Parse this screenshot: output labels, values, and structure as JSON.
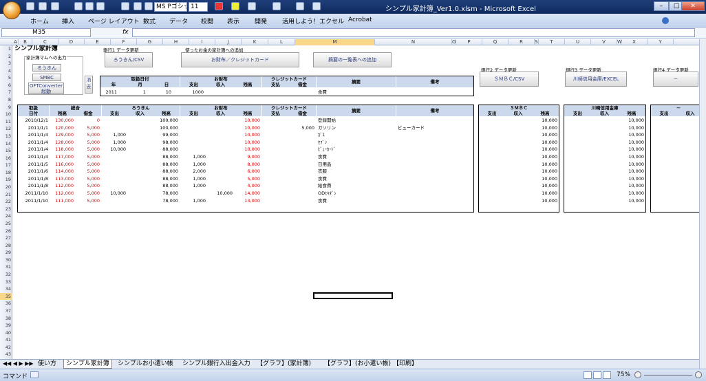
{
  "window": {
    "title": "シンプル家計簿_Ver1.0.xlsm - Microsoft Excel",
    "minimize": "–",
    "restore": "□",
    "close": "✕"
  },
  "quick_access": {
    "font_name": "MS Pゴシッ",
    "font_size": "11"
  },
  "ribbon_tabs": [
    "ホーム",
    "挿入",
    "ページ レイアウト",
    "数式",
    "データ",
    "校閲",
    "表示",
    "開発",
    "活用しよう！エクセル",
    "Acrobat"
  ],
  "formula_bar": {
    "name_box": "M35",
    "fx": "fx",
    "value": ""
  },
  "columns": [
    "A",
    "B",
    "C",
    "D",
    "E",
    "F",
    "G",
    "H",
    "I",
    "J",
    "K",
    "L",
    "M",
    "N",
    "O",
    "P",
    "Q",
    "R",
    "S",
    "T",
    "U",
    "V",
    "W",
    "X",
    "Y"
  ],
  "sheet": {
    "title": "シンプル家計簿",
    "group_output": "家計簿マムへの出力",
    "btn_rokin": "ろうきん",
    "btn_smbc": "SMBC",
    "btn_ofx": "OFTConverter起動",
    "btn_clear": "消去",
    "group_bank1": "銀行1 データ更新",
    "btn_bank1": "ろうきん/CSV",
    "group_add": "使ったお金の家計簿への追加",
    "btn_add": "お財布／クレジットカード",
    "btn_summary": "摘要の一覧表への追加",
    "group_bank2": "銀行2 データ更新",
    "btn_bank2": "ＳＭＢＣ/CSV",
    "group_bank3": "銀行3 データ更新",
    "btn_bank3": "川崎信用金庫/EXCEL",
    "group_bank4": "銀行4 データ更新",
    "btn_bank4": "－",
    "input_header": {
      "date": "取扱日付",
      "year": "年",
      "month": "月",
      "day": "日",
      "wallet": "お財布",
      "out": "支出",
      "in": "収入",
      "bal": "残高",
      "credit": "クレジットカード",
      "pay": "支払",
      "debt": "借金",
      "memo": "摘要",
      "note": "備考"
    },
    "input_row": {
      "year": "2011",
      "month": "1",
      "day": "10",
      "wallet_out": "1000",
      "memo": "食費"
    },
    "main_header": {
      "date1": "取扱",
      "date2": "日付",
      "total": "総合",
      "bal": "残高",
      "debt": "借金",
      "rokin": "ろうきん",
      "wallet": "お財布",
      "credit": "クレジットカード",
      "out": "支出",
      "in": "収入",
      "pay": "支払",
      "memo": "摘要",
      "note": "備考",
      "smbc": "ＳＭＢＣ",
      "kawasaki": "川崎信用金庫",
      "bank4": "－"
    },
    "rows": [
      {
        "date": "2010/12/1",
        "total": "130,000",
        "debt": "0",
        "r_out": "",
        "r_bal": "100,000",
        "w_out": "",
        "w_in": "",
        "w_bal": "10,000",
        "c_pay": "",
        "c_debt": "",
        "memo": "登録開始",
        "note": "",
        "s_bal": "10,000",
        "k_bal": "10,000"
      },
      {
        "date": "2011/1/1",
        "total": "120,000",
        "debt": "5,000",
        "r_out": "",
        "r_bal": "100,000",
        "w_out": "",
        "w_in": "",
        "w_bal": "10,000",
        "c_pay": "",
        "c_debt": "5,000",
        "memo": "ガソリン",
        "note": "ビューカード",
        "s_bal": "10,000",
        "k_bal": "10,000"
      },
      {
        "date": "2011/1/4",
        "total": "129,000",
        "debt": "5,000",
        "r_out": "1,000",
        "r_bal": "99,000",
        "w_out": "",
        "w_in": "",
        "w_bal": "10,000",
        "c_pay": "",
        "c_debt": "",
        "memo": "ｶﾞｽ",
        "note": "",
        "s_bal": "10,000",
        "k_bal": "10,000"
      },
      {
        "date": "2011/1/4",
        "total": "128,000",
        "debt": "5,000",
        "r_out": "1,000",
        "r_bal": "98,000",
        "w_out": "",
        "w_in": "",
        "w_bal": "10,000",
        "c_pay": "",
        "c_debt": "",
        "memo": "ｾﾌﾞﾝ",
        "note": "",
        "s_bal": "10,000",
        "k_bal": "10,000"
      },
      {
        "date": "2011/1/4",
        "total": "118,000",
        "debt": "5,000",
        "r_out": "10,000",
        "r_bal": "88,000",
        "w_out": "",
        "w_in": "",
        "w_bal": "10,000",
        "c_pay": "",
        "c_debt": "",
        "memo": "ﾋﾞｭｰｶｰﾄﾞ",
        "note": "",
        "s_bal": "10,000",
        "k_bal": "10,000"
      },
      {
        "date": "2011/1/4",
        "total": "117,000",
        "debt": "5,000",
        "r_out": "",
        "r_bal": "88,000",
        "w_out": "1,000",
        "w_in": "",
        "w_bal": "9,000",
        "c_pay": "",
        "c_debt": "",
        "memo": "食費",
        "note": "",
        "s_bal": "10,000",
        "k_bal": "10,000"
      },
      {
        "date": "2011/1/5",
        "total": "116,000",
        "debt": "5,000",
        "r_out": "",
        "r_bal": "88,000",
        "w_out": "1,000",
        "w_in": "",
        "w_bal": "8,000",
        "c_pay": "",
        "c_debt": "",
        "memo": "日用品",
        "note": "",
        "s_bal": "10,000",
        "k_bal": "10,000"
      },
      {
        "date": "2011/1/6",
        "total": "114,000",
        "debt": "5,000",
        "r_out": "",
        "r_bal": "88,000",
        "w_out": "2,000",
        "w_in": "",
        "w_bal": "6,000",
        "c_pay": "",
        "c_debt": "",
        "memo": "衣服",
        "note": "",
        "s_bal": "10,000",
        "k_bal": "10,000"
      },
      {
        "date": "2011/1/8",
        "total": "113,000",
        "debt": "5,000",
        "r_out": "",
        "r_bal": "88,000",
        "w_out": "1,000",
        "w_in": "",
        "w_bal": "5,000",
        "c_pay": "",
        "c_debt": "",
        "memo": "食費",
        "note": "",
        "s_bal": "10,000",
        "k_bal": "10,000"
      },
      {
        "date": "2011/1/8",
        "total": "112,000",
        "debt": "5,000",
        "r_out": "",
        "r_bal": "88,000",
        "w_out": "1,000",
        "w_in": "",
        "w_bal": "4,000",
        "c_pay": "",
        "c_debt": "",
        "memo": "給食費",
        "note": "",
        "s_bal": "10,000",
        "k_bal": "10,000"
      },
      {
        "date": "2011/1/10",
        "total": "112,000",
        "debt": "5,000",
        "r_out": "10,000",
        "r_bal": "78,000",
        "w_out": "",
        "w_in": "10,000",
        "w_bal": "14,000",
        "c_pay": "",
        "c_debt": "",
        "memo": "ODﾋｷﾀﾞｼ",
        "note": "",
        "s_bal": "10,000",
        "k_bal": "10,000"
      },
      {
        "date": "2011/1/10",
        "total": "111,000",
        "debt": "5,000",
        "r_out": "",
        "r_bal": "78,000",
        "w_out": "1,000",
        "w_in": "",
        "w_bal": "13,000",
        "c_pay": "",
        "c_debt": "",
        "memo": "食費",
        "note": "",
        "s_bal": "10,000",
        "k_bal": "10,000"
      }
    ]
  },
  "row_numbers": [
    "1",
    "2",
    "3",
    "4",
    "5",
    "6",
    "7",
    "8",
    "9",
    "10",
    "11",
    "12",
    "13",
    "14",
    "15",
    "16",
    "17",
    "18",
    "19",
    "20",
    "21",
    "22",
    "23",
    "24",
    "25",
    "26",
    "27",
    "28",
    "29",
    "30",
    "31",
    "32",
    "33",
    "34",
    "35",
    "36",
    "37",
    "38",
    "39",
    "40",
    "41",
    "42",
    "43"
  ],
  "sheet_tabs": [
    "使い方",
    "シンプル家計簿",
    "シンプルお小遣い帳",
    "シンプル銀行入出金入力",
    "【グラフ】(家計簿)",
    "【グラフ】(お小遣い帳)",
    "【印刷】"
  ],
  "active_tab": "シンプル家計簿",
  "status": {
    "mode": "コマンド",
    "zoom": "75%"
  }
}
